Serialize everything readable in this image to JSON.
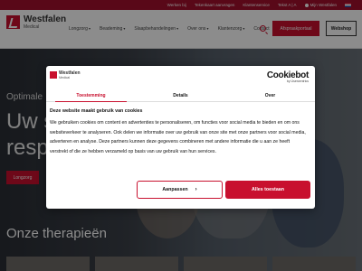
{
  "topbar": {
    "links": [
      "Werken bij",
      "Tekenkaart aanvragen",
      "Klantenservice",
      "Tekst  A | A",
      "Mijn Westfalen"
    ],
    "flag_icon": "flag-nl-icon"
  },
  "header": {
    "logo_name": "Westfalen",
    "logo_sub": "Medical",
    "nav": [
      "Longzorg",
      "Beademing",
      "Slaapbehandelingen",
      "Over ons",
      "Klantenzorg",
      "Contact"
    ],
    "appointment_label": "Afspraakportaal",
    "webshop_label": "Webshop",
    "accent_color": "#c8102e"
  },
  "hero": {
    "kicker": "Optimale",
    "title_line1": "Uw s",
    "title_line2": "respi",
    "cta_label": "Longzorg",
    "section_title": "Onze therapieën"
  },
  "dialog": {
    "logo_name": "Westfalen",
    "logo_sub": "Medical",
    "cookiebot_name": "Cookiebot",
    "cookiebot_by": "by Usercentrics",
    "tabs": [
      "Toestemming",
      "Details",
      "Over"
    ],
    "heading": "Deze website maakt gebruik van cookies",
    "body": "We gebruiken cookies om content en advertenties te personaliseren, om functies voor social media te bieden en om ons websiteverkeer te analyseren. Ook delen we informatie over uw gebruik van onze site met onze partners voor social media, adverteren en analyse. Deze partners kunnen deze gegevens combineren met andere informatie die u aan ze heeft verstrekt of die ze hebben verzameld op basis van uw gebruik van hun services.",
    "customize_label": "Aanpassen",
    "allow_all_label": "Alles toestaan"
  }
}
